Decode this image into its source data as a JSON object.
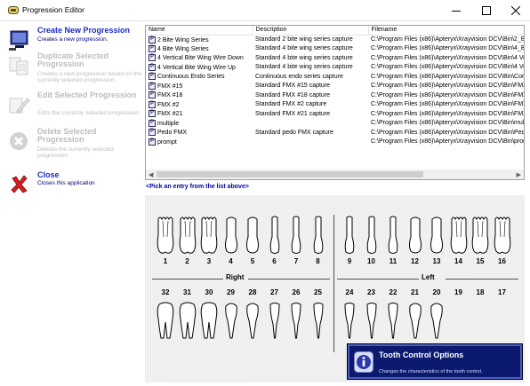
{
  "window": {
    "title": "Progression Editor"
  },
  "actions": [
    {
      "label": "Create New Progression",
      "desc": "Creates a new progression.",
      "enabled": true
    },
    {
      "label": "Duplicate Selected Progression",
      "desc": "Creates a new progression based on the currently selected progression.",
      "enabled": false
    },
    {
      "label": "Edit Selected Progression",
      "desc": "Edits the currently selected progression.",
      "enabled": false
    },
    {
      "label": "Delete Selected Progression",
      "desc": "Deletes the currently selected progression.",
      "enabled": false
    },
    {
      "label": "Close",
      "desc": "Closes this application",
      "enabled": true
    }
  ],
  "list": {
    "columns": [
      "Name",
      "Description",
      "Filename"
    ],
    "rows": [
      {
        "name": "2 Bite Wing Series",
        "description": "Standard 2 bite wing series capture",
        "filename": "C:\\Program Files (x86)\\Apteryx\\Xrayvision DCV\\Bin\\2_B"
      },
      {
        "name": "4 Bite Wing Series",
        "description": "Standard 4 bite wing series capture",
        "filename": "C:\\Program Files (x86)\\Apteryx\\Xrayvision DCV\\Bin\\4_B"
      },
      {
        "name": "4 Vertical Bite Wing Wire Down",
        "description": "Standard 4 bite wing series capture",
        "filename": "C:\\Program Files (x86)\\Apteryx\\Xrayvision DCV\\Bin\\4 Ve"
      },
      {
        "name": "4 Vertical Bite Wing Wire Up",
        "description": "Standard 4 bite wing series capture",
        "filename": "C:\\Program Files (x86)\\Apteryx\\Xrayvision DCV\\Bin\\4 Ve"
      },
      {
        "name": "Continuous Endo Series",
        "description": "Continuous endo series capture",
        "filename": "C:\\Program Files (x86)\\Apteryx\\Xrayvision DCV\\Bin\\Con"
      },
      {
        "name": "FMX #15",
        "description": "Standard FMX #15 capture",
        "filename": "C:\\Program Files (x86)\\Apteryx\\Xrayvision DCV\\Bin\\FMX"
      },
      {
        "name": "FMX #18",
        "description": "Standard FMX #18 capture",
        "filename": "C:\\Program Files (x86)\\Apteryx\\Xrayvision DCV\\Bin\\FMX"
      },
      {
        "name": "FMX #2",
        "description": "Standard FMX #2 capture",
        "filename": "C:\\Program Files (x86)\\Apteryx\\Xrayvision DCV\\Bin\\FMX"
      },
      {
        "name": "FMX #21",
        "description": "Standard FMX #21 capture",
        "filename": "C:\\Program Files (x86)\\Apteryx\\Xrayvision DCV\\Bin\\FMX"
      },
      {
        "name": "multiple",
        "description": "",
        "filename": "C:\\Program Files (x86)\\Apteryx\\Xrayvision DCV\\Bin\\mult"
      },
      {
        "name": "Pedo FMX",
        "description": "Standard pedo FMX capture",
        "filename": "C:\\Program Files (x86)\\Apteryx\\Xrayvision DCV\\Bin\\Ped"
      },
      {
        "name": "prompt",
        "description": "",
        "filename": "C:\\Program Files (x86)\\Apteryx\\Xrayvision DCV\\Bin\\pron"
      }
    ]
  },
  "hint": "<Pick an entry from the list above>",
  "teeth": {
    "upper": [
      "1",
      "2",
      "3",
      "4",
      "5",
      "6",
      "7",
      "8",
      "9",
      "10",
      "11",
      "12",
      "13",
      "14",
      "15",
      "16"
    ],
    "lower": [
      "32",
      "31",
      "30",
      "29",
      "28",
      "27",
      "26",
      "25",
      "24",
      "23",
      "22",
      "21",
      "20",
      "19",
      "18",
      "17"
    ],
    "right_label": "Right",
    "left_label": "Left"
  },
  "tooth_control": {
    "title": "Tooth Control Options",
    "desc": "Changes the characteristics of the tooth control."
  },
  "icons": {
    "app": "progression-editor-app-icon",
    "create": "monitor-create-icon",
    "duplicate": "duplicate-pages-icon",
    "edit": "edit-pencil-icon",
    "delete": "delete-x-circle-icon",
    "close": "close-x-icon",
    "info": "info-icon"
  },
  "colors": {
    "action_label": "#1c2bc0",
    "disabled": "#bdbdbd",
    "hint": "#0000a0",
    "tco_bg": "#0b1a6e"
  }
}
